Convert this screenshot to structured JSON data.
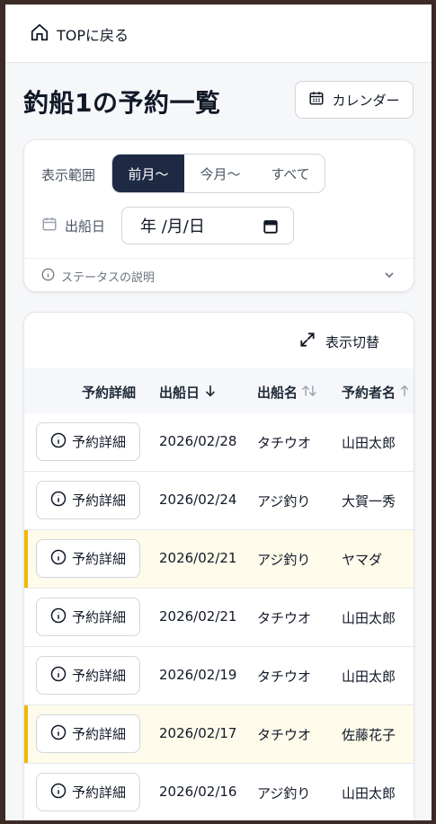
{
  "topbar": {
    "back_label": "TOPに戻る"
  },
  "page": {
    "title": "釣船1の予約一覧",
    "calendar_label": "カレンダー"
  },
  "filter": {
    "range_label": "表示範囲",
    "segments": [
      "前月〜",
      "今月〜",
      "すべて"
    ],
    "active_segment": "前月〜",
    "date_label": "出船日",
    "date_value": "年 /月/日",
    "status_help": "ステータスの説明"
  },
  "table": {
    "toggle_label": "表示切替",
    "headers": [
      "予約詳細",
      "出船日",
      "出船名",
      "予約者名"
    ],
    "detail_label": "予約詳細",
    "rows": [
      {
        "date": "2026/02/28",
        "boat": "タチウオ",
        "name": "山田太郎",
        "highlight": false
      },
      {
        "date": "2026/02/24",
        "boat": "アジ釣り",
        "name": "大賀一秀",
        "highlight": false
      },
      {
        "date": "2026/02/21",
        "boat": "アジ釣り",
        "name": "ヤマダ",
        "highlight": true
      },
      {
        "date": "2026/02/21",
        "boat": "タチウオ",
        "name": "山田太郎",
        "highlight": false
      },
      {
        "date": "2026/02/19",
        "boat": "タチウオ",
        "name": "山田太郎",
        "highlight": false
      },
      {
        "date": "2026/02/17",
        "boat": "タチウオ",
        "name": "佐藤花子",
        "highlight": true
      },
      {
        "date": "2026/02/16",
        "boat": "アジ釣り",
        "name": "山田太郎",
        "highlight": false
      }
    ]
  },
  "colors": {
    "accent_dark": "#1e2a44",
    "highlight_bar": "#f2b705",
    "highlight_bg": "#fefbea"
  }
}
